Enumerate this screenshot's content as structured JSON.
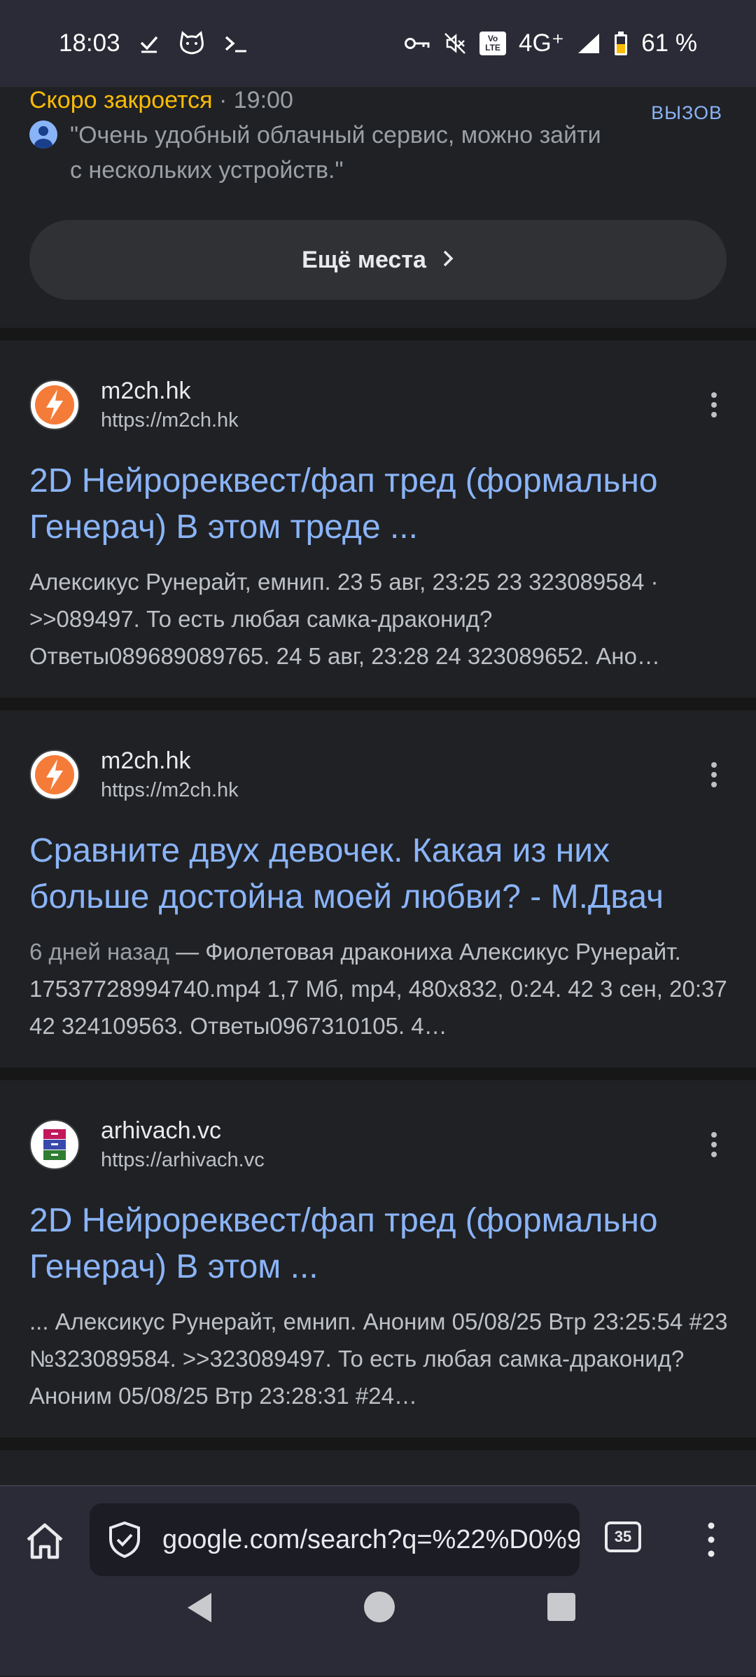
{
  "status_bar": {
    "time": "18:03",
    "network": "4G⁺",
    "volte": "Vo LTE",
    "battery": "61 %"
  },
  "place": {
    "closing_status": "Скоро закроется",
    "closing_time": " · 19:00",
    "call_label": "ВЫЗОВ",
    "review": "\"Очень удобный облачный сервис, можно зайти с нескольких устройств.\"",
    "more_places_label": "Ещё места"
  },
  "results": [
    {
      "site_name": "m2ch.hk",
      "site_url": "https://m2ch.hk",
      "title": "2D Нейрореквест/фап тред (формально Генерач) В этом треде ...",
      "date": "",
      "snippet": "Алексикус Рунерайт, емнип. 23 5 авг, 23:25 23 323089584 · >>089497. То есть любая самка-драконид? Ответы089689089765. 24 5 авг, 23:28 24 323089652. Ано…"
    },
    {
      "site_name": "m2ch.hk",
      "site_url": "https://m2ch.hk",
      "title": "Сравните двух девочек. Какая из них больше достойна моей любви? - М.Двач",
      "date": "6 дней назад",
      "snippet": " — Фиолетовая дракониха Алексикус Рунерайт. 17537728994740.mp4 1,7 Мб, mp4, 480x832, 0:24. 42 3 сен, 20:37 42 324109563. Ответы0967310105. 4…"
    },
    {
      "site_name": "arhivach.vc",
      "site_url": "https://arhivach.vc",
      "title": "2D Нейрореквест/фап тред (формально Генерач) В этом ...",
      "date": "",
      "snippet": "... Алексикус Рунерайт, емнип. Аноним 05/08/25 Втр 23:25:54 #23 №323089584. >>323089497. То есть любая самка-драконид? Аноним 05/08/25 Втр 23:28:31 #24…"
    }
  ],
  "browser": {
    "url": "google.com/search?q=%22%D0%9",
    "tab_count": "35"
  },
  "colors": {
    "link": "#8ab4f8",
    "warning": "#fbbc04",
    "background": "#202124",
    "bar": "#2a2b36"
  }
}
